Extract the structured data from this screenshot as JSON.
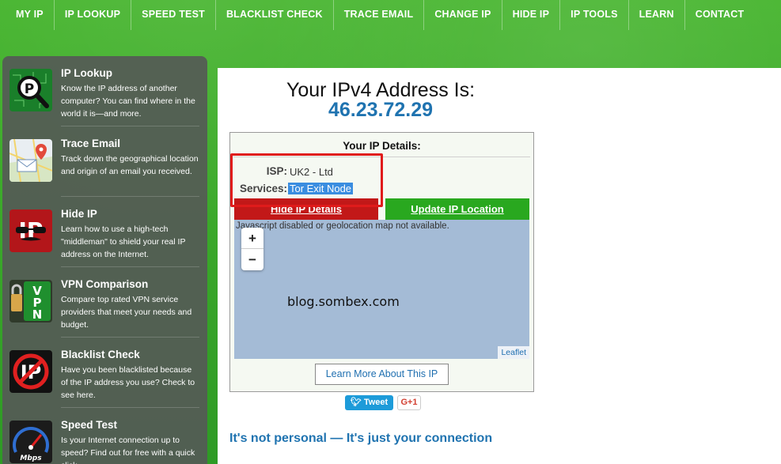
{
  "nav": {
    "items": [
      "MY IP",
      "IP LOOKUP",
      "SPEED TEST",
      "BLACKLIST CHECK",
      "TRACE EMAIL",
      "CHANGE IP",
      "HIDE IP",
      "IP TOOLS",
      "LEARN",
      "CONTACT"
    ]
  },
  "sidebar": {
    "items": [
      {
        "title": "IP Lookup",
        "desc": "Know the IP address of another computer? You can find where in the world it is—and more.",
        "icon": "magnifier-ip-icon"
      },
      {
        "title": "Trace Email",
        "desc": "Track down the geographical location and origin of an email you received.",
        "icon": "map-pin-icon"
      },
      {
        "title": "Hide IP",
        "desc": "Learn how to use a high-tech \"middleman\" to shield your real IP address on the Internet.",
        "icon": "disguise-ip-icon"
      },
      {
        "title": "VPN Comparison",
        "desc": "Compare top rated VPN service providers that meet your needs and budget.",
        "icon": "vpn-lock-icon"
      },
      {
        "title": "Blacklist Check",
        "desc": "Have you been blacklisted because of the IP address you use? Check to see here.",
        "icon": "blacklist-ip-icon"
      },
      {
        "title": "Speed Test",
        "desc": "Is your Internet connection up to speed? Find out for free with a quick click.",
        "icon": "speedometer-icon"
      }
    ]
  },
  "main": {
    "heading": "Your IPv4 Address Is:",
    "ip": "46.23.72.29",
    "details_title": "Your IP Details:",
    "isp_label": "ISP:",
    "isp_value": "UK2 - Ltd",
    "services_label": "Services:",
    "services_value": "Tor Exit Node",
    "hide_btn": "Hide IP Details",
    "update_btn": "Update IP Location",
    "map_msg": "Javascript disabled or geolocation map not available.",
    "zoom_in": "+",
    "zoom_out": "−",
    "watermark": "blog.sombex.com",
    "leaflet": "Leaflet",
    "learn_btn": "Learn More About This IP",
    "tweet": "Tweet",
    "gplus": "G+1",
    "bottom_heading": "It's not personal — It's just your connection"
  },
  "colors": {
    "nav_green": "#3aa52a",
    "ip_blue": "#1f73b0",
    "hide_red": "#c21818",
    "update_green": "#29a81f",
    "highlight_red": "#e01b1b"
  }
}
